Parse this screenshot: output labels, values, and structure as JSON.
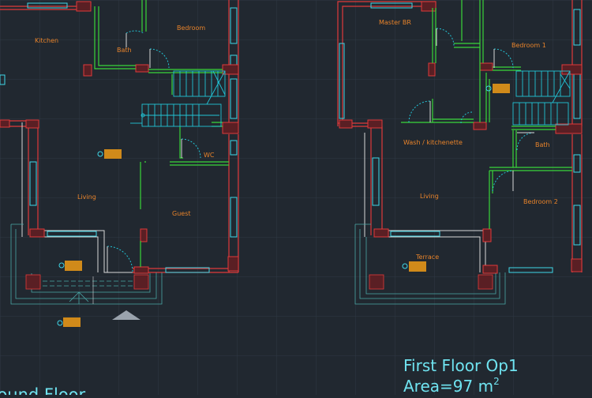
{
  "colors": {
    "background": "#212830",
    "grid": "#2e3944",
    "wall_red": "#e03a3a",
    "wall_white": "#d8d8d8",
    "window_cyan": "#3fd7e8",
    "partition_green": "#39d639",
    "stair_cyan": "#22c4d6",
    "room_label": "#e8832a",
    "title_text": "#6fe3f0",
    "furniture_orange": "#d08a1a"
  },
  "ground_floor": {
    "rooms": {
      "kitchen": "Kitchen",
      "bath": "Bath",
      "bedroom": "Bedroom",
      "wc": "WC",
      "living": "Living",
      "guest": "Guest"
    },
    "title": "Ground Floor"
  },
  "first_floor": {
    "rooms": {
      "master_br": "Master BR",
      "bedroom_1": "Bedroom 1",
      "bath": "Bath",
      "wash_kitchenette": "Wash / kitchenette",
      "living": "Living",
      "bedroom_2": "Bedroom 2",
      "terrace": "Terrace"
    },
    "title": "First  Floor Op1",
    "area_label": "Area=97 m",
    "area_exponent": "2"
  }
}
